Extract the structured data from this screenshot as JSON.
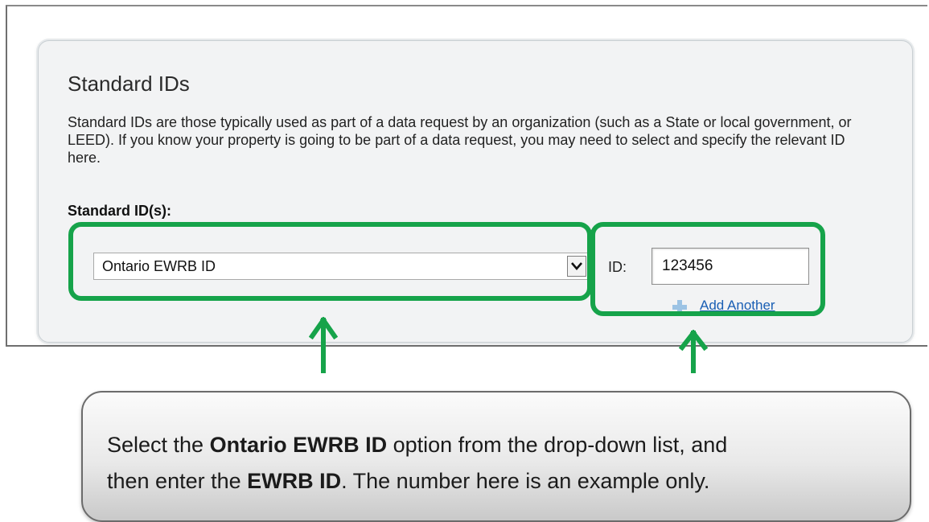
{
  "panel": {
    "title": "Standard IDs",
    "description": "Standard IDs are those typically used as part of a data request by an organization (such as a State or local government, or LEED). If you know your property is going to be part of a data request, you may need to select and specify the relevant ID here.",
    "field_label": "Standard ID(s):",
    "select": {
      "selected_value": "Ontario EWRB ID"
    },
    "id_field": {
      "label": "ID:",
      "value": "123456"
    },
    "add_link": {
      "icon": "plus-icon",
      "label": "Add Another"
    }
  },
  "callout": {
    "line1": {
      "t1": "Select the ",
      "b1": "Ontario EWRB ID",
      "t2": " option from the drop-down list, and"
    },
    "line2": {
      "t1": "then enter the ",
      "b1": "EWRB ID",
      "t2": ". The number here is an example only."
    }
  },
  "colors": {
    "highlight": "#16a34a",
    "link": "#1a5fb4"
  }
}
